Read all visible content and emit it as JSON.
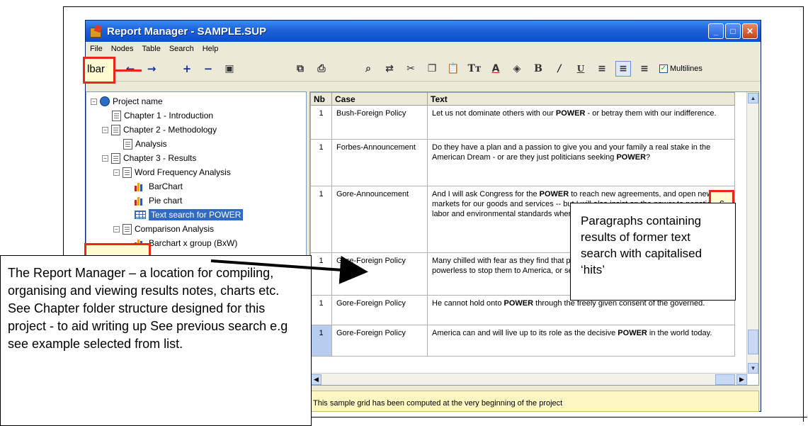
{
  "window": {
    "title": "Report Manager - SAMPLE.SUP",
    "buttons": [
      "_",
      "□",
      "✕"
    ]
  },
  "menu": [
    "File",
    "Nodes",
    "Table",
    "Search",
    "Help"
  ],
  "toolbar": {
    "multilines_label": "Multilines",
    "multilines_checked": true
  },
  "tree": {
    "items": [
      {
        "label": "Project name",
        "level": 0,
        "icon": "project-icon"
      },
      {
        "label": "Chapter 1 - Introduction",
        "level": 1,
        "icon": "document-icon"
      },
      {
        "label": "Chapter 2 - Methodology",
        "level": 1,
        "icon": "document-icon"
      },
      {
        "label": "Analysis",
        "level": 2,
        "icon": "document-icon"
      },
      {
        "label": "Chapter 3 - Results",
        "level": 1,
        "icon": "document-icon"
      },
      {
        "label": "Word Frequency Analysis",
        "level": 2,
        "icon": "document-icon"
      },
      {
        "label": "BarChart",
        "level": 3,
        "icon": "bar-chart-icon"
      },
      {
        "label": "Pie chart",
        "level": 3,
        "icon": "pie-chart-icon"
      },
      {
        "label": "Text search for POWER",
        "level": 3,
        "icon": "grid-icon",
        "selected": true
      },
      {
        "label": "Comparison Analysis",
        "level": 2,
        "icon": "document-icon"
      },
      {
        "label": "Barchart x group (BxW)",
        "level": 3,
        "icon": "bar-chart-icon"
      }
    ]
  },
  "grid": {
    "headers": [
      "Nb",
      "Case",
      "Text"
    ],
    "rows": [
      {
        "nb": "1",
        "case": "Bush-Foreign Policy",
        "pre": "Let us not dominate others with our ",
        "hit": "POWER",
        "post": " - or betray them with our indifference."
      },
      {
        "nb": "1",
        "case": "Forbes-Announcement",
        "pre": "Do they have a plan and a passion to give you and your family a real stake in the American Dream - or are they just politicians seeking ",
        "hit": "POWER",
        "post": "?"
      },
      {
        "nb": "1",
        "case": "Gore-Announcement",
        "pre": "And I will ask Congress for the ",
        "hit": "POWER",
        "post": " to reach new agreements, and open new markets for our goods and services -- but I will also insist on the power to negotiate labor and environmental standards where necessary."
      },
      {
        "nb": "1",
        "case": "Gore-Foreign Policy",
        "pre": "Many chilled with fear as they find that police and customs officials who may be powerless to stop them to America, or send them back.",
        "hit": "",
        "post": ""
      },
      {
        "nb": "1",
        "case": "Gore-Foreign Policy",
        "pre": "He cannot hold onto ",
        "hit": "POWER",
        "post": " through the freely given consent of the governed."
      },
      {
        "nb": "1",
        "case": "Gore-Foreign Policy",
        "pre": "America can and will live up to its role as the decisive ",
        "hit": "POWER",
        "post": " in the world today."
      }
    ]
  },
  "status": "This sample grid has been computed at the very beginning of the project",
  "annotations": {
    "left_callout": "The Report Manager – a location for compiling, organising and viewing results  notes, charts etc. See Chapter folder structure designed for this project  - to aid writing up  See previous search e.g see  example selected from list.",
    "right_callout": "Paragraphs containing results of former text search with capitalised ‘hits’",
    "toolbar_tag": "lbar",
    "right_tag": "c"
  }
}
